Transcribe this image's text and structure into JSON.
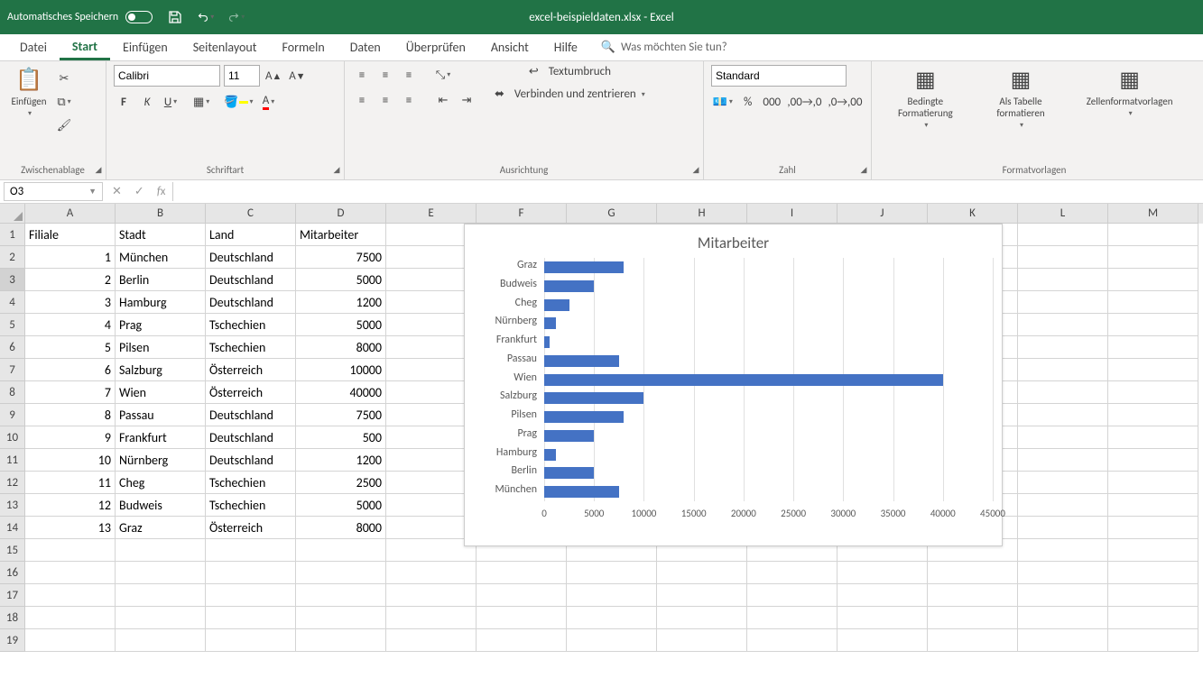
{
  "title": "excel-beispieldaten.xlsx  -  Excel",
  "autosave": "Automatisches Speichern",
  "tabs": [
    "Datei",
    "Start",
    "Einfügen",
    "Seitenlayout",
    "Formeln",
    "Daten",
    "Überprüfen",
    "Ansicht",
    "Hilfe"
  ],
  "active_tab": 1,
  "tellme": "Was möchten Sie tun?",
  "groups": {
    "clipboard": {
      "paste": "Einfügen",
      "label": "Zwischenablage"
    },
    "font": {
      "name": "Calibri",
      "size": "11",
      "label": "Schriftart"
    },
    "align": {
      "wrap": "Textumbruch",
      "merge": "Verbinden und zentrieren",
      "label": "Ausrichtung"
    },
    "number": {
      "format": "Standard",
      "label": "Zahl"
    },
    "styles": {
      "cond": "Bedingte Formatierung",
      "table": "Als Tabelle formatieren",
      "cell": "Zellenformatvorlagen",
      "label": "Formatvorlagen"
    }
  },
  "namebox": "O3",
  "columns": [
    "A",
    "B",
    "C",
    "D",
    "E",
    "F",
    "G",
    "H",
    "I",
    "J",
    "K",
    "L",
    "M"
  ],
  "headers": [
    "Filiale",
    "Stadt",
    "Land",
    "Mitarbeiter"
  ],
  "rows": [
    {
      "f": 1,
      "s": "München",
      "l": "Deutschland",
      "m": 7500
    },
    {
      "f": 2,
      "s": "Berlin",
      "l": "Deutschland",
      "m": 5000
    },
    {
      "f": 3,
      "s": "Hamburg",
      "l": "Deutschland",
      "m": 1200
    },
    {
      "f": 4,
      "s": "Prag",
      "l": "Tschechien",
      "m": 5000
    },
    {
      "f": 5,
      "s": "Pilsen",
      "l": "Tschechien",
      "m": 8000
    },
    {
      "f": 6,
      "s": "Salzburg",
      "l": "Österreich",
      "m": 10000
    },
    {
      "f": 7,
      "s": "Wien",
      "l": "Österreich",
      "m": 40000
    },
    {
      "f": 8,
      "s": "Passau",
      "l": "Deutschland",
      "m": 7500
    },
    {
      "f": 9,
      "s": "Frankfurt",
      "l": "Deutschland",
      "m": 500
    },
    {
      "f": 10,
      "s": "Nürnberg",
      "l": "Deutschland",
      "m": 1200
    },
    {
      "f": 11,
      "s": "Cheg",
      "l": "Tschechien",
      "m": 2500
    },
    {
      "f": 12,
      "s": "Budweis",
      "l": "Tschechien",
      "m": 5000
    },
    {
      "f": 13,
      "s": "Graz",
      "l": "Österreich",
      "m": 8000
    }
  ],
  "empty_rows": 5,
  "chart_data": {
    "type": "bar",
    "title": "Mitarbeiter",
    "categories": [
      "Graz",
      "Budweis",
      "Cheg",
      "Nürnberg",
      "Frankfurt",
      "Passau",
      "Wien",
      "Salzburg",
      "Pilsen",
      "Prag",
      "Hamburg",
      "Berlin",
      "München"
    ],
    "values": [
      8000,
      5000,
      2500,
      1200,
      500,
      7500,
      40000,
      10000,
      8000,
      5000,
      1200,
      5000,
      7500
    ],
    "xticks": [
      0,
      5000,
      10000,
      15000,
      20000,
      25000,
      30000,
      35000,
      40000,
      45000
    ],
    "xlim": 45000,
    "xlabel": "",
    "ylabel": ""
  }
}
